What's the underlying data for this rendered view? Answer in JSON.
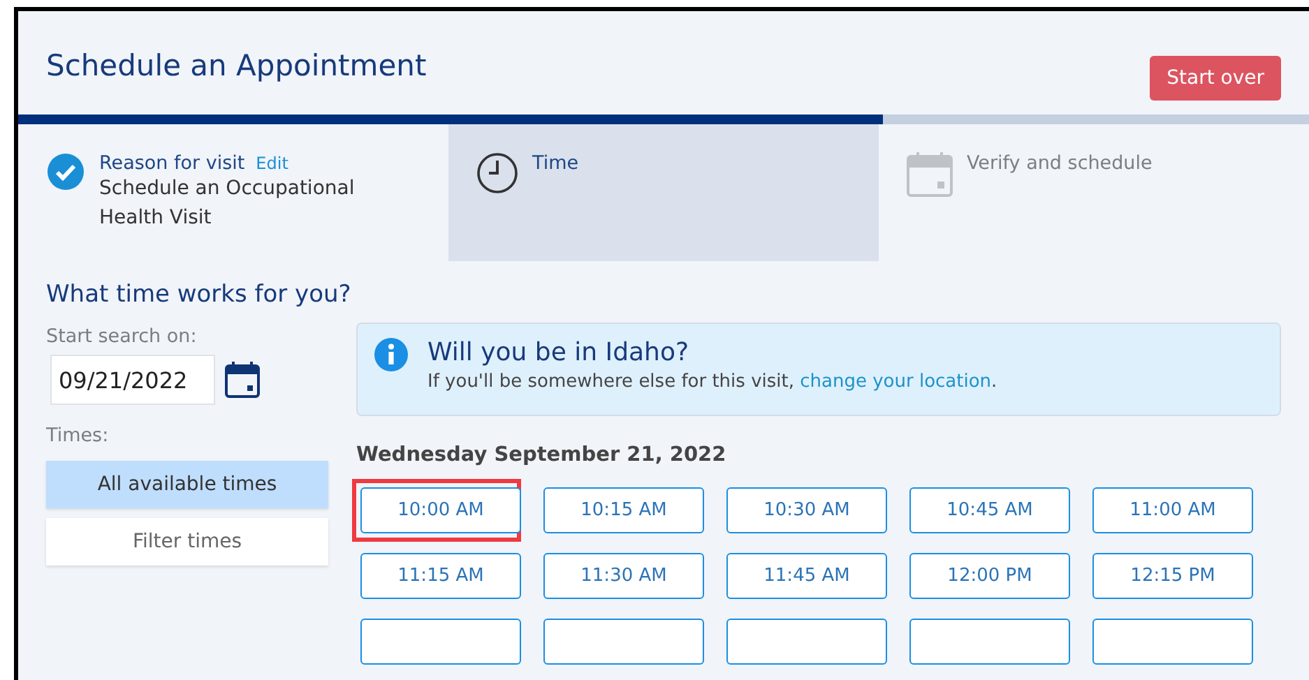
{
  "header": {
    "title": "Schedule an Appointment",
    "button": "Start over"
  },
  "progress": {
    "level": 0.67
  },
  "steps": [
    {
      "kind": "done",
      "label": "Reason for visit",
      "edit": "Edit",
      "detail": "Schedule an Occupational Health Visit",
      "selected": false
    },
    {
      "kind": "current",
      "label": "Time",
      "selected": true
    },
    {
      "kind": "pending",
      "label": "Verify and schedule",
      "selected": false
    }
  ],
  "question": "What time works for you?",
  "search": {
    "label": "Start search on:",
    "value": "09/21/2022"
  },
  "times_filter": {
    "label": "Times:",
    "options": [
      {
        "label": "All available times",
        "selected": true
      },
      {
        "label": "Filter times",
        "selected": false
      }
    ]
  },
  "notice": {
    "title": "Will you be in Idaho?",
    "text": "If you'll be somewhere else for this visit, ",
    "link": "change your location",
    "end": "."
  },
  "day": {
    "heading": "Wednesday September 21, 2022",
    "slots": [
      {
        "label": "10:00 AM",
        "highlighted": true
      },
      {
        "label": "10:15 AM",
        "highlighted": false
      },
      {
        "label": "10:30 AM",
        "highlighted": false
      },
      {
        "label": "10:45 AM",
        "highlighted": false
      },
      {
        "label": "11:00 AM",
        "highlighted": false
      },
      {
        "label": "11:15 AM",
        "highlighted": false
      },
      {
        "label": "11:30 AM",
        "highlighted": false
      },
      {
        "label": "11:45 AM",
        "highlighted": false
      },
      {
        "label": "12:00 PM",
        "highlighted": false
      },
      {
        "label": "12:15 PM",
        "highlighted": false
      },
      {
        "highlighted": false
      },
      {
        "highlighted": false
      },
      {
        "highlighted": false
      },
      {
        "highlighted": false
      },
      {
        "highlighted": false
      }
    ]
  }
}
